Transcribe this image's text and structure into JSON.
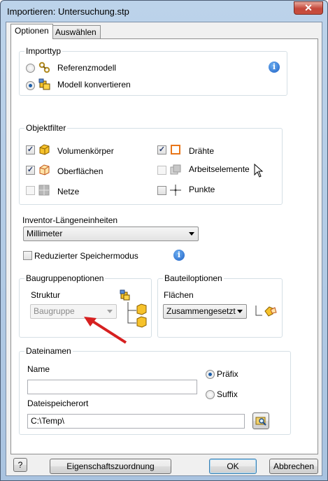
{
  "window": {
    "title": "Importieren: Untersuchung.stp",
    "close_glyph": "✕"
  },
  "tabs": [
    {
      "label": "Optionen",
      "active": true
    },
    {
      "label": "Auswählen",
      "active": false
    }
  ],
  "importtyp": {
    "legend": "Importtyp",
    "options": [
      {
        "label": "Referenzmodell",
        "selected": false,
        "icon": "reference-link-icon"
      },
      {
        "label": "Modell konvertieren",
        "selected": true,
        "icon": "convert-model-icon"
      }
    ]
  },
  "objektfilter": {
    "legend": "Objektfilter",
    "items": [
      {
        "label": "Volumenkörper",
        "checked": true,
        "enabled": true,
        "icon": "solid-body-icon"
      },
      {
        "label": "Oberflächen",
        "checked": true,
        "enabled": true,
        "icon": "surface-icon"
      },
      {
        "label": "Netze",
        "checked": false,
        "enabled": false,
        "icon": "mesh-icon"
      },
      {
        "label": "Drähte",
        "checked": true,
        "enabled": true,
        "icon": "wire-icon"
      },
      {
        "label": "Arbeitselemente",
        "checked": false,
        "enabled": false,
        "icon": "work-feature-icon"
      },
      {
        "label": "Punkte",
        "checked": false,
        "enabled": true,
        "icon": "point-icon"
      }
    ]
  },
  "units": {
    "label": "Inventor-Längeneinheiten",
    "selected": "Millimeter"
  },
  "memory_mode": {
    "label": "Reduzierter Speichermodus",
    "checked": false
  },
  "baugruppe": {
    "legend": "Baugruppenoptionen",
    "struktur_label": "Struktur",
    "struktur_value": "Baugruppe"
  },
  "bauteil": {
    "legend": "Bauteiloptionen",
    "flaechen_label": "Flächen",
    "flaechen_value": "Zusammengesetzt"
  },
  "dateinamen": {
    "legend": "Dateinamen",
    "name_label": "Name",
    "name_value": "",
    "praefix_label": "Präfix",
    "suffix_label": "Suffix",
    "praefix_selected": true,
    "speicherort_label": "Dateispeicherort",
    "speicherort_value": "C:\\Temp\\"
  },
  "footer": {
    "help_glyph": "?",
    "mapping_label": "Eigenschaftszuordnung",
    "ok_label": "OK",
    "cancel_label": "Abbrechen"
  },
  "colors": {
    "accent": "#1c5da8",
    "annotation_arrow": "#d62020",
    "titlebar": "#bcd3ea"
  }
}
